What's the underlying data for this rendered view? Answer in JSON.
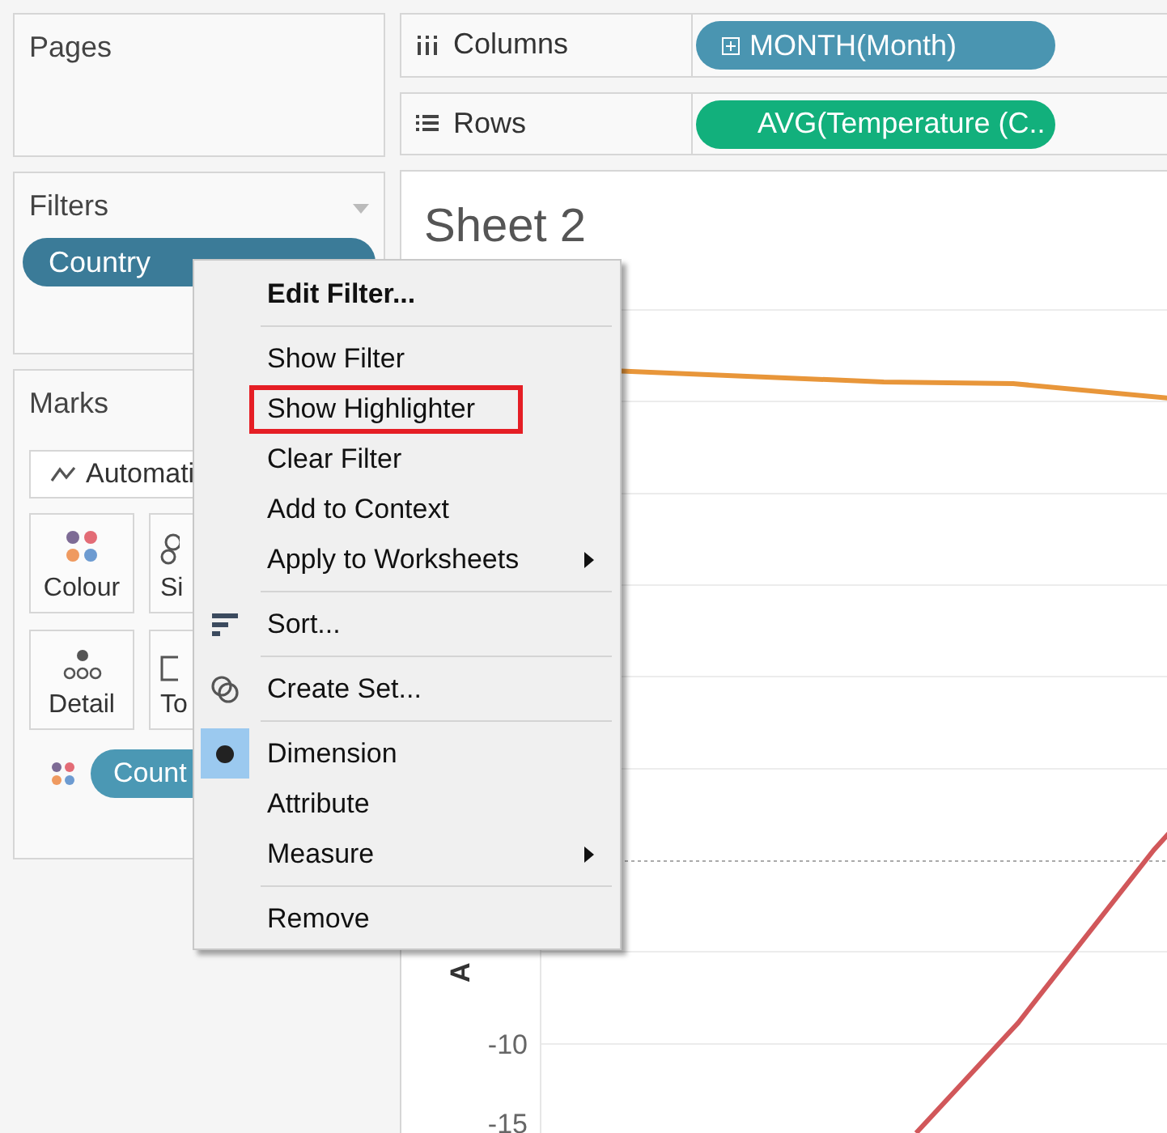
{
  "pages": {
    "title": "Pages"
  },
  "filters": {
    "title": "Filters",
    "pills": [
      {
        "text": "Country",
        "color": "#3b7b98"
      }
    ]
  },
  "marks": {
    "title": "Marks",
    "mark_type": "Automati",
    "buttons": [
      {
        "kind": "colour",
        "label": "Colour"
      },
      {
        "kind": "size",
        "label": "Si"
      },
      {
        "kind": "detail",
        "label": "Detail"
      },
      {
        "kind": "tooltip",
        "label": "To"
      }
    ],
    "fields": [
      {
        "kind": "colour",
        "text": "Count",
        "color": "#4b98b4"
      }
    ]
  },
  "shelves": [
    {
      "kind": "columns",
      "label": "Columns",
      "pill": {
        "text": "MONTH(Month)",
        "color": "#4a95b1",
        "expand_icon": true
      }
    },
    {
      "kind": "rows",
      "label": "Rows",
      "pill": {
        "text": "AVG(Temperature (C..",
        "color": "#12b07c",
        "expand_icon": false
      }
    }
  ],
  "sheet": {
    "title": "Sheet 2",
    "y_axis_title": "A",
    "y_tick_labels": [
      "-10",
      "-15"
    ]
  },
  "context_menu": [
    {
      "kind": "item",
      "label": "Edit Filter...",
      "bold": true,
      "submenu": false,
      "highlighted": false
    },
    {
      "kind": "separator"
    },
    {
      "kind": "item",
      "label": "Show Filter",
      "bold": false,
      "submenu": false,
      "highlighted": false
    },
    {
      "kind": "item",
      "label": "Show Highlighter",
      "bold": false,
      "submenu": false,
      "highlighted": true
    },
    {
      "kind": "item",
      "label": "Clear Filter",
      "bold": false,
      "submenu": false,
      "highlighted": false
    },
    {
      "kind": "item",
      "label": "Add to Context",
      "bold": false,
      "submenu": false,
      "highlighted": false
    },
    {
      "kind": "item",
      "label": "Apply to Worksheets",
      "bold": false,
      "submenu": true,
      "highlighted": false
    },
    {
      "kind": "separator"
    },
    {
      "kind": "sort",
      "label": "Sort...",
      "bold": false,
      "submenu": false,
      "highlighted": false
    },
    {
      "kind": "separator"
    },
    {
      "kind": "set",
      "label": "Create Set...",
      "bold": false,
      "submenu": false,
      "highlighted": false
    },
    {
      "kind": "separator"
    },
    {
      "kind": "radio",
      "label": "Dimension",
      "selected": true,
      "submenu": false
    },
    {
      "kind": "radio",
      "label": "Attribute",
      "selected": false,
      "submenu": false
    },
    {
      "kind": "radio",
      "label": "Measure",
      "selected": false,
      "submenu": true
    },
    {
      "kind": "separator"
    },
    {
      "kind": "item",
      "label": "Remove",
      "bold": false,
      "submenu": false,
      "highlighted": false
    }
  ]
}
